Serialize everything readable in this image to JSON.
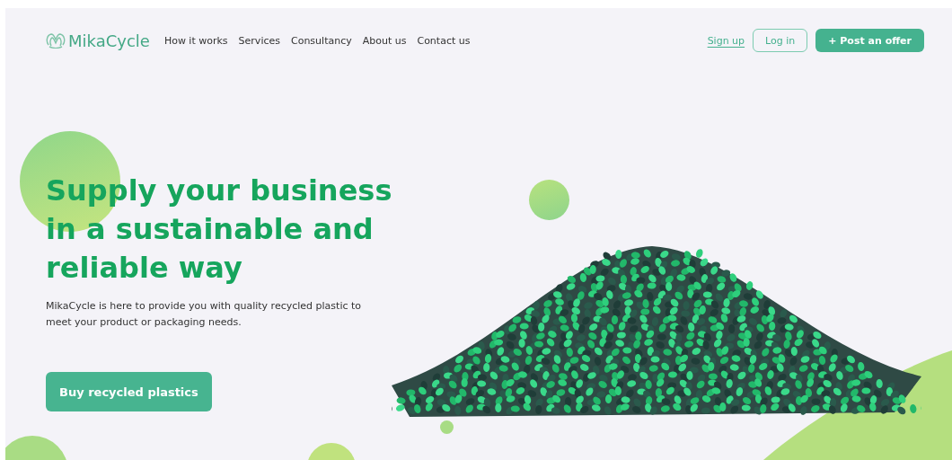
{
  "logo": {
    "text": "MikaCycle"
  },
  "nav": [
    {
      "label": "How it works"
    },
    {
      "label": "Services"
    },
    {
      "label": "Consultancy"
    },
    {
      "label": "About us"
    },
    {
      "label": "Contact us"
    }
  ],
  "actions": [
    {
      "kind": "link",
      "label": "Sign up"
    },
    {
      "kind": "outline",
      "label": "Log in"
    },
    {
      "kind": "filled",
      "label": "+ Post an offer"
    }
  ],
  "hero": {
    "title": "Supply your business in a sustainable and reliable way",
    "text": "MikaCycle is here to provide you with quality recycled plastic to meet your product or packaging needs.",
    "button": "Buy recycled plastics"
  }
}
